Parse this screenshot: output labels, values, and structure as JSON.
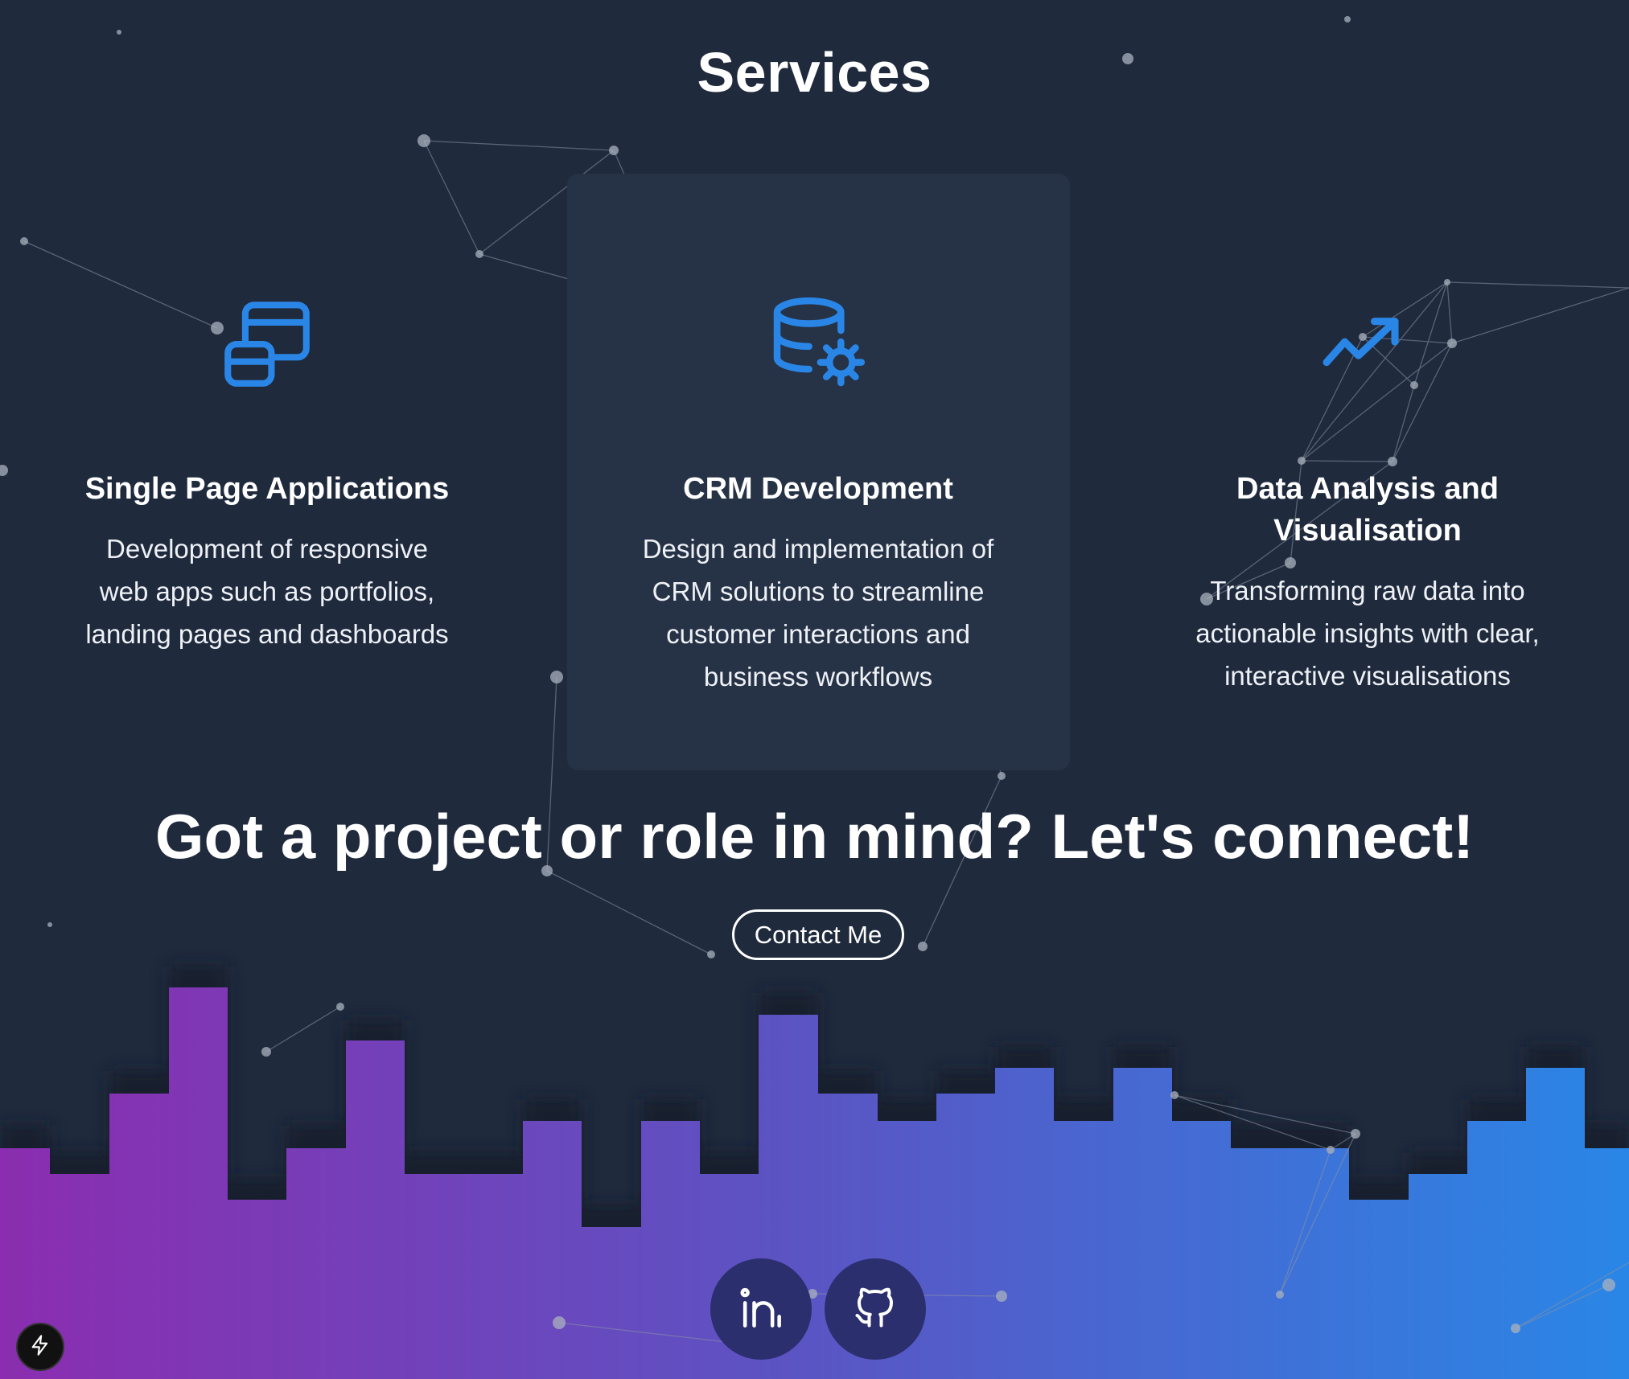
{
  "services_section": {
    "title": "Services",
    "items": [
      {
        "icon": "browser-windows-icon",
        "title": "Single Page Applications",
        "description_lines": [
          "Development of responsive",
          "web apps such as portfolios,",
          "landing pages and dashboards"
        ]
      },
      {
        "icon": "database-gear-icon",
        "title": "CRM Development",
        "description_lines": [
          "Design and implementation of",
          "CRM solutions to streamline",
          "customer interactions and",
          "business workflows"
        ]
      },
      {
        "icon": "trending-up-icon",
        "title": "Data Analysis and Visualisation",
        "description_lines": [
          "Transforming raw data into",
          "actionable insights with clear,",
          "interactive visualisations"
        ]
      }
    ]
  },
  "cta": {
    "title": "Got a project or role in mind? Let's connect!",
    "button_label": "Contact Me"
  },
  "social_links": [
    {
      "icon": "linkedin-icon"
    },
    {
      "icon": "github-icon"
    }
  ],
  "corner_badge": {
    "icon": "lightning-icon"
  },
  "colors": {
    "background": "#1f2a3d",
    "accent": "#2a86e6",
    "gradient_start": "#8b2db0",
    "gradient_end": "#2a86e6"
  }
}
